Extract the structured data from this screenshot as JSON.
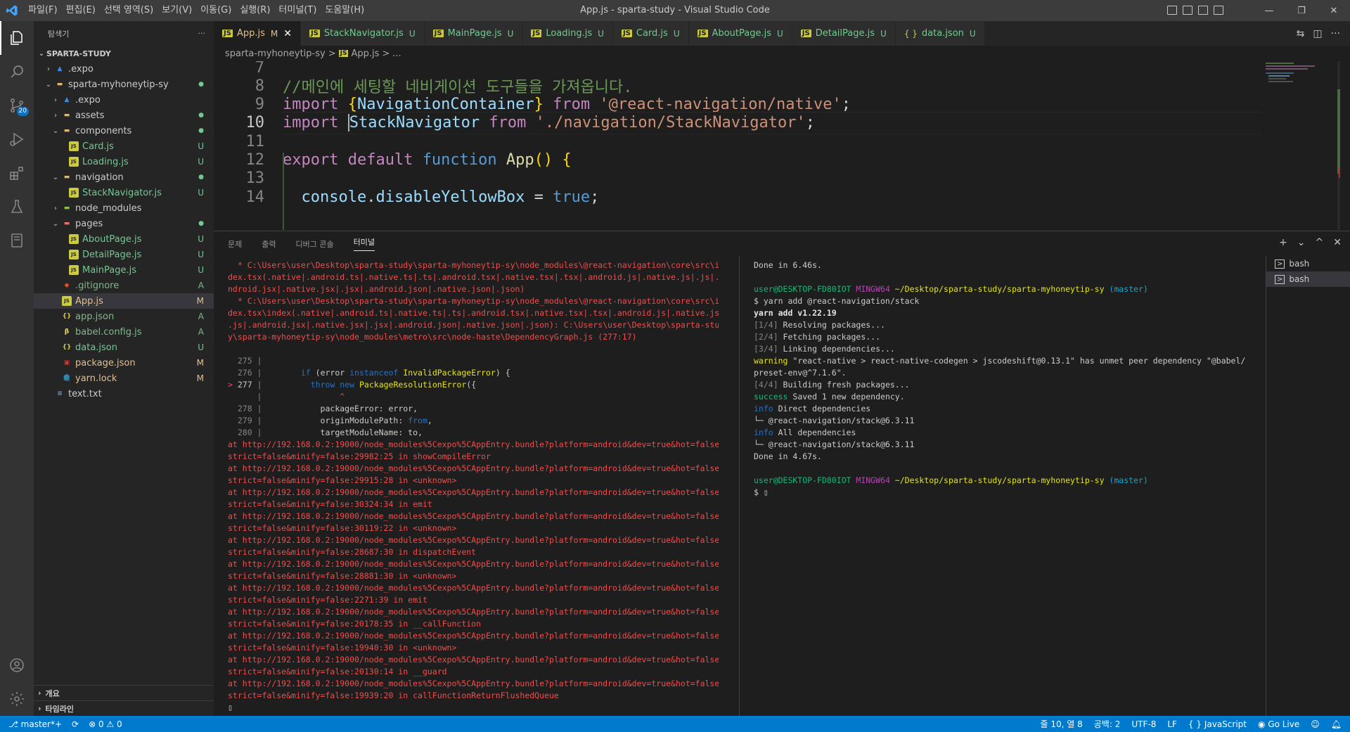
{
  "window": {
    "title": "App.js - sparta-study - Visual Studio Code",
    "menu": [
      "파일(F)",
      "편집(E)",
      "선택 영역(S)",
      "보기(V)",
      "이동(G)",
      "실행(R)",
      "터미널(T)",
      "도움말(H)"
    ],
    "controls": [
      "—",
      "❐",
      "✕"
    ]
  },
  "activity_bar": {
    "scm_badge": "20",
    "icons": [
      "explorer-icon",
      "search-icon",
      "source-control-icon",
      "run-debug-icon",
      "extensions-icon",
      "testing-icon",
      "remote-icon"
    ],
    "bottom_icons": [
      "account-icon",
      "settings-gear-icon"
    ]
  },
  "explorer": {
    "title": "탐색기",
    "more": "···",
    "root": "SPARTA-STUDY",
    "items": [
      {
        "label": ".expo",
        "indent": 1,
        "type": "folder-expo",
        "chev": "›",
        "status": ""
      },
      {
        "label": "sparta-myhoneytip-sy",
        "indent": 1,
        "type": "folder",
        "chev": "⌄",
        "status": "●"
      },
      {
        "label": ".expo",
        "indent": 2,
        "type": "folder-expo",
        "chev": "›",
        "status": ""
      },
      {
        "label": "assets",
        "indent": 2,
        "type": "folder",
        "chev": "›",
        "status": "●"
      },
      {
        "label": "components",
        "indent": 2,
        "type": "folder",
        "chev": "⌄",
        "status": "●"
      },
      {
        "label": "Card.js",
        "indent": 3,
        "type": "js",
        "chev": "",
        "status": "U"
      },
      {
        "label": "Loading.js",
        "indent": 3,
        "type": "js",
        "chev": "",
        "status": "U"
      },
      {
        "label": "navigation",
        "indent": 2,
        "type": "folder",
        "chev": "⌄",
        "status": "●"
      },
      {
        "label": "StackNavigator.js",
        "indent": 3,
        "type": "js",
        "chev": "",
        "status": "U"
      },
      {
        "label": "node_modules",
        "indent": 2,
        "type": "folder-node",
        "chev": "›",
        "status": ""
      },
      {
        "label": "pages",
        "indent": 2,
        "type": "folder-pages",
        "chev": "⌄",
        "status": "●"
      },
      {
        "label": "AboutPage.js",
        "indent": 3,
        "type": "js",
        "chev": "",
        "status": "U"
      },
      {
        "label": "DetailPage.js",
        "indent": 3,
        "type": "js",
        "chev": "",
        "status": "U"
      },
      {
        "label": "MainPage.js",
        "indent": 3,
        "type": "js",
        "chev": "",
        "status": "U"
      },
      {
        "label": ".gitignore",
        "indent": 2,
        "type": "git",
        "chev": "",
        "status": "A"
      },
      {
        "label": "App.js",
        "indent": 2,
        "type": "js",
        "chev": "",
        "status": "M",
        "selected": true
      },
      {
        "label": "app.json",
        "indent": 2,
        "type": "json",
        "chev": "",
        "status": "A"
      },
      {
        "label": "babel.config.js",
        "indent": 2,
        "type": "babel",
        "chev": "",
        "status": "A"
      },
      {
        "label": "data.json",
        "indent": 2,
        "type": "json",
        "chev": "",
        "status": "U"
      },
      {
        "label": "package.json",
        "indent": 2,
        "type": "npm",
        "chev": "",
        "status": "M"
      },
      {
        "label": "yarn.lock",
        "indent": 2,
        "type": "yarn",
        "chev": "",
        "status": "M"
      },
      {
        "label": "text.txt",
        "indent": 1,
        "type": "txt",
        "chev": "",
        "status": ""
      }
    ],
    "footer": [
      "개요",
      "타임라인"
    ]
  },
  "tabs": [
    {
      "label": "App.js",
      "flag": "M",
      "active": true,
      "type": "js"
    },
    {
      "label": "StackNavigator.js",
      "flag": "U",
      "active": false,
      "type": "js"
    },
    {
      "label": "MainPage.js",
      "flag": "U",
      "active": false,
      "type": "js"
    },
    {
      "label": "Loading.js",
      "flag": "U",
      "active": false,
      "type": "js"
    },
    {
      "label": "Card.js",
      "flag": "U",
      "active": false,
      "type": "js"
    },
    {
      "label": "AboutPage.js",
      "flag": "U",
      "active": false,
      "type": "js"
    },
    {
      "label": "DetailPage.js",
      "flag": "U",
      "active": false,
      "type": "js"
    },
    {
      "label": "data.json",
      "flag": "U",
      "active": false,
      "type": "json"
    }
  ],
  "breadcrumb": [
    "sparta-myhoneytip-sy",
    ">",
    "App.js",
    ">",
    "..."
  ],
  "editor": {
    "lines": [
      {
        "n": "7",
        "tokens": []
      },
      {
        "n": "8",
        "tokens": [
          [
            "com",
            "//메인에 세팅할 네비게이션 도구들을 가져옵니다."
          ]
        ]
      },
      {
        "n": "9",
        "tokens": [
          [
            "kw",
            "import "
          ],
          [
            "br",
            "{"
          ],
          [
            "var",
            "NavigationContainer"
          ],
          [
            "br",
            "}"
          ],
          [
            "kw",
            " from "
          ],
          [
            "str",
            "'@react-navigation/native'"
          ],
          [
            "pl",
            ";"
          ]
        ]
      },
      {
        "n": "10",
        "tokens": [
          [
            "kw",
            "import "
          ],
          [
            "var",
            "StackNavigator"
          ],
          [
            "kw",
            " from "
          ],
          [
            "str",
            "'./navigation/StackNavigator'"
          ],
          [
            "pl",
            ";"
          ]
        ],
        "current": true
      },
      {
        "n": "11",
        "tokens": []
      },
      {
        "n": "12",
        "tokens": [
          [
            "kw",
            "export default "
          ],
          [
            "bl",
            "function "
          ],
          [
            "fn",
            "App"
          ],
          [
            "br",
            "() {"
          ]
        ]
      },
      {
        "n": "13",
        "tokens": []
      },
      {
        "n": "14",
        "tokens": [
          [
            "pl",
            "  "
          ],
          [
            "var",
            "console"
          ],
          [
            "pl",
            "."
          ],
          [
            "var",
            "disableYellowBox"
          ],
          [
            "pl",
            " = "
          ],
          [
            "bl",
            "true"
          ],
          [
            "pl",
            ";"
          ]
        ]
      }
    ]
  },
  "panel": {
    "tabs": [
      "문제",
      "출력",
      "디버그 콘솔",
      "터미널"
    ],
    "active_tab": "터미널",
    "tools": [
      "+",
      "⌄",
      "^",
      "✕"
    ],
    "terminals": [
      "bash",
      "bash"
    ]
  },
  "terminal_left": [
    [
      [
        "red",
        "  * C:\\Users\\user\\Desktop\\sparta-study\\sparta-myhoneytip-sy\\node_modules\\@react-navigation\\core\\src\\in"
      ]
    ],
    [
      [
        "red",
        "dex.tsx(.native|.android.ts|.native.ts|.ts|.android.tsx|.native.tsx|.tsx|.android.js|.native.js|.js|.a"
      ]
    ],
    [
      [
        "red",
        "ndroid.jsx|.native.jsx|.jsx|.android.json|.native.json|.json)"
      ]
    ],
    [
      [
        "red",
        "  * C:\\Users\\user\\Desktop\\sparta-study\\sparta-myhoneytip-sy\\node_modules\\@react-navigation\\core\\src\\in"
      ]
    ],
    [
      [
        "red",
        "dex.tsx\\index(.native|.android.ts|.native.ts|.ts|.android.tsx|.native.tsx|.tsx|.android.js|.native.js|"
      ]
    ],
    [
      [
        "red",
        ".js|.android.jsx|.native.jsx|.jsx|.android.json|.native.json|.json): C:\\Users\\user\\Desktop\\sparta-stud"
      ]
    ],
    [
      [
        "red",
        "y\\sparta-myhoneytip-sy\\node_modules\\metro\\src\\node-haste\\DependencyGraph.js (277:17)"
      ]
    ],
    [
      [
        "w",
        ""
      ]
    ],
    [
      [
        "dim",
        "  275 |"
      ]
    ],
    [
      [
        "dim",
        "  276 |"
      ],
      [
        "w",
        "        "
      ],
      [
        "blue",
        "if "
      ],
      [
        "w",
        "(error "
      ],
      [
        "blue",
        "instanceof "
      ],
      [
        "yellow",
        "InvalidPackageError"
      ],
      [
        "w",
        ") {"
      ]
    ],
    [
      [
        "red",
        "> "
      ],
      [
        "w",
        "277 "
      ],
      [
        "dim",
        "|"
      ],
      [
        "w",
        "          "
      ],
      [
        "blue",
        "throw new "
      ],
      [
        "yellow",
        "PackageResolutionError"
      ],
      [
        "w",
        "({"
      ]
    ],
    [
      [
        "dim",
        "      |"
      ],
      [
        "red",
        "                ^"
      ]
    ],
    [
      [
        "dim",
        "  278 |"
      ],
      [
        "w",
        "            packageError: error,"
      ]
    ],
    [
      [
        "dim",
        "  279 |"
      ],
      [
        "w",
        "            originModulePath: "
      ],
      [
        "blue",
        "from"
      ],
      [
        "w",
        ","
      ]
    ],
    [
      [
        "dim",
        "  280 |"
      ],
      [
        "w",
        "            targetModuleName: to,"
      ]
    ],
    [
      [
        "red",
        "at http://192.168.0.2:19000/node_modules%5Cexpo%5CAppEntry.bundle?platform=android&dev=true&hot=false&"
      ]
    ],
    [
      [
        "red",
        "strict=false&minify=false:29982:25 in showCompileError"
      ]
    ],
    [
      [
        "red",
        "at http://192.168.0.2:19000/node_modules%5Cexpo%5CAppEntry.bundle?platform=android&dev=true&hot=false&"
      ]
    ],
    [
      [
        "red",
        "strict=false&minify=false:29915:28 in <unknown>"
      ]
    ],
    [
      [
        "red",
        "at http://192.168.0.2:19000/node_modules%5Cexpo%5CAppEntry.bundle?platform=android&dev=true&hot=false&"
      ]
    ],
    [
      [
        "red",
        "strict=false&minify=false:30324:34 in emit"
      ]
    ],
    [
      [
        "red",
        "at http://192.168.0.2:19000/node_modules%5Cexpo%5CAppEntry.bundle?platform=android&dev=true&hot=false&"
      ]
    ],
    [
      [
        "red",
        "strict=false&minify=false:30119:22 in <unknown>"
      ]
    ],
    [
      [
        "red",
        "at http://192.168.0.2:19000/node_modules%5Cexpo%5CAppEntry.bundle?platform=android&dev=true&hot=false&"
      ]
    ],
    [
      [
        "red",
        "strict=false&minify=false:28687:30 in dispatchEvent"
      ]
    ],
    [
      [
        "red",
        "at http://192.168.0.2:19000/node_modules%5Cexpo%5CAppEntry.bundle?platform=android&dev=true&hot=false&"
      ]
    ],
    [
      [
        "red",
        "strict=false&minify=false:28881:30 in <unknown>"
      ]
    ],
    [
      [
        "red",
        "at http://192.168.0.2:19000/node_modules%5Cexpo%5CAppEntry.bundle?platform=android&dev=true&hot=false&"
      ]
    ],
    [
      [
        "red",
        "strict=false&minify=false:2271:39 in emit"
      ]
    ],
    [
      [
        "red",
        "at http://192.168.0.2:19000/node_modules%5Cexpo%5CAppEntry.bundle?platform=android&dev=true&hot=false&"
      ]
    ],
    [
      [
        "red",
        "strict=false&minify=false:20178:35 in __callFunction"
      ]
    ],
    [
      [
        "red",
        "at http://192.168.0.2:19000/node_modules%5Cexpo%5CAppEntry.bundle?platform=android&dev=true&hot=false&"
      ]
    ],
    [
      [
        "red",
        "strict=false&minify=false:19940:30 in <unknown>"
      ]
    ],
    [
      [
        "red",
        "at http://192.168.0.2:19000/node_modules%5Cexpo%5CAppEntry.bundle?platform=android&dev=true&hot=false&"
      ]
    ],
    [
      [
        "red",
        "strict=false&minify=false:20130:14 in __guard"
      ]
    ],
    [
      [
        "red",
        "at http://192.168.0.2:19000/node_modules%5Cexpo%5CAppEntry.bundle?platform=android&dev=true&hot=false&"
      ]
    ],
    [
      [
        "red",
        "strict=false&minify=false:19939:20 in callFunctionReturnFlushedQueue"
      ]
    ],
    [
      [
        "w",
        "▯"
      ]
    ]
  ],
  "terminal_right": [
    [
      [
        "w",
        "Done in 6.46s."
      ]
    ],
    [
      [
        "w",
        ""
      ]
    ],
    [
      [
        "green",
        "user@DESKTOP-FD80IOT "
      ],
      [
        "magenta",
        "MINGW64 "
      ],
      [
        "yellow",
        "~/Desktop/sparta-study/sparta-myhoneytip-sy "
      ],
      [
        "cyan",
        "(master)"
      ]
    ],
    [
      [
        "w",
        "$ yarn add @react-navigation/stack"
      ]
    ],
    [
      [
        "bold",
        "yarn add v1.22.19"
      ]
    ],
    [
      [
        "dim",
        "[1/4]"
      ],
      [
        "w",
        " Resolving packages..."
      ]
    ],
    [
      [
        "dim",
        "[2/4]"
      ],
      [
        "w",
        " Fetching packages..."
      ]
    ],
    [
      [
        "dim",
        "[3/4]"
      ],
      [
        "w",
        " Linking dependencies..."
      ]
    ],
    [
      [
        "yellow",
        "warning"
      ],
      [
        "w",
        " \"react-native > react-native-codegen > jscodeshift@0.13.1\" has unmet peer dependency \"@babel/"
      ]
    ],
    [
      [
        "w",
        "preset-env@^7.1.6\"."
      ]
    ],
    [
      [
        "dim",
        "[4/4]"
      ],
      [
        "w",
        " Building fresh packages..."
      ]
    ],
    [
      [
        "green",
        "success"
      ],
      [
        "w",
        " Saved 1 new dependency."
      ]
    ],
    [
      [
        "blue",
        "info"
      ],
      [
        "w",
        " Direct dependencies"
      ]
    ],
    [
      [
        "w",
        "└─ @react-navigation/stack@6.3.11"
      ]
    ],
    [
      [
        "blue",
        "info"
      ],
      [
        "w",
        " All dependencies"
      ]
    ],
    [
      [
        "w",
        "└─ @react-navigation/stack@6.3.11"
      ]
    ],
    [
      [
        "w",
        "Done in 4.67s."
      ]
    ],
    [
      [
        "w",
        ""
      ]
    ],
    [
      [
        "green",
        "user@DESKTOP-FD80IOT "
      ],
      [
        "magenta",
        "MINGW64 "
      ],
      [
        "yellow",
        "~/Desktop/sparta-study/sparta-myhoneytip-sy "
      ],
      [
        "cyan",
        "(master)"
      ]
    ],
    [
      [
        "w",
        "$ ▯"
      ]
    ]
  ],
  "statusbar": {
    "branch": "master*+",
    "sync": "⟳",
    "problems": "⊗ 0 ⚠ 0",
    "position": "줄 10, 열 8",
    "spaces": "공백: 2",
    "encoding": "UTF-8",
    "eol": "LF",
    "language": "{ } JavaScript",
    "golive": "Go Live"
  },
  "colors": {
    "accent": "#007acc",
    "titlebar": "#3c3c3c",
    "sidebar": "#252526",
    "editor": "#1e1e1e"
  }
}
